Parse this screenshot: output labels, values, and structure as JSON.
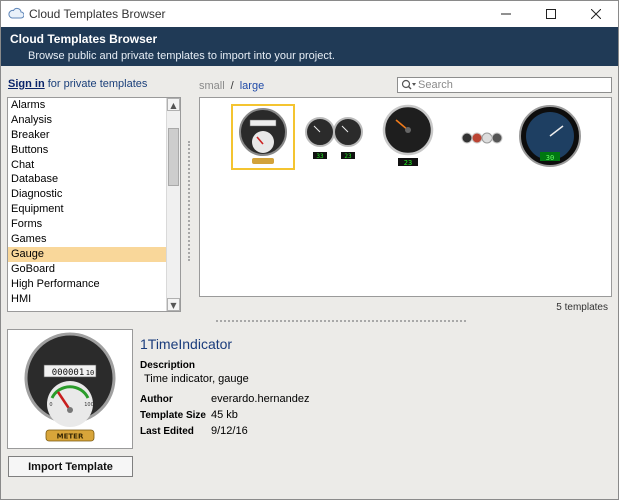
{
  "window": {
    "title": "Cloud Templates Browser",
    "minimize": "—",
    "maximize": "☐",
    "close": "✕"
  },
  "header": {
    "title": "Cloud Templates Browser",
    "subtitle": "Browse public and private templates to import into your project."
  },
  "signin": {
    "link": "Sign in",
    "rest": " for private templates"
  },
  "categories": [
    "Alarms",
    "Analysis",
    "Breaker",
    "Buttons",
    "Chat",
    "Database",
    "Diagnostic",
    "Equipment",
    "Forms",
    "Games",
    "Gauge",
    "GoBoard",
    "High Performance",
    "HMI"
  ],
  "selected_category": "Gauge",
  "view": {
    "small": "small",
    "separator": "/",
    "large": "large"
  },
  "search": {
    "placeholder": "Search"
  },
  "templates_count": "5 templates",
  "thumb_readouts": {
    "t2a": "33",
    "t2b": "23",
    "t3": "23",
    "t5": "30"
  },
  "selected": {
    "name": "1TimeIndicator",
    "description_label": "Description",
    "description": "Time indicator, gauge",
    "author_label": "Author",
    "author": "everardo.hernandez",
    "size_label": "Template Size",
    "size": "45 kb",
    "edited_label": "Last Edited",
    "edited": "9/12/16",
    "counter": "000001",
    "counter_tail": "10",
    "scale_low": "0",
    "scale_high": "100",
    "meter": "METER"
  },
  "import_button": "Import Template",
  "colors": {
    "header_bg": "#203a56",
    "selection": "#f9d79a",
    "thumb_select": "#f4c430",
    "link": "#1f4aa8"
  }
}
